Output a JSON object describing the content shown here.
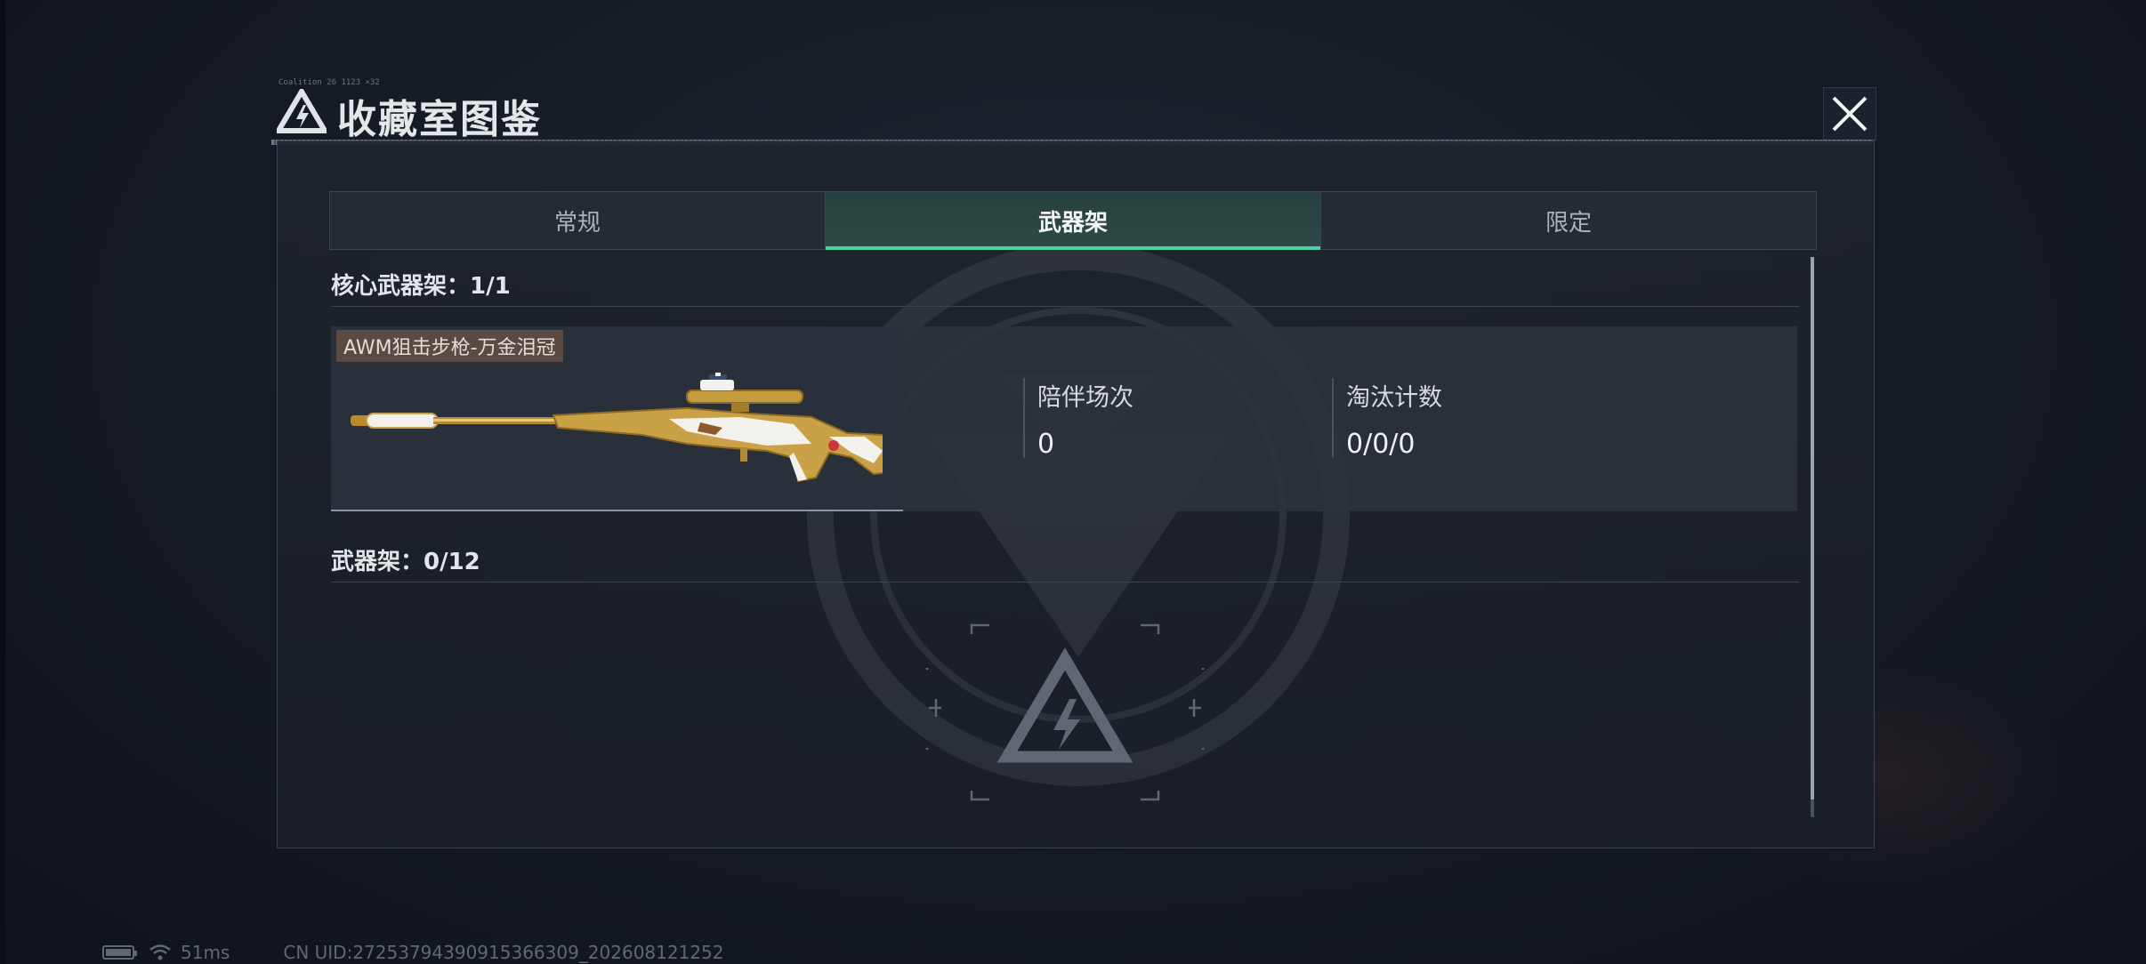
{
  "header": {
    "title": "收藏室图鉴",
    "tiny_caption": "Coalition 26 1123 ×32"
  },
  "tabs": [
    {
      "label": "常规",
      "active": false
    },
    {
      "label": "武器架",
      "active": true
    },
    {
      "label": "限定",
      "active": false
    }
  ],
  "core_section": {
    "label": "核心武器架：1/1"
  },
  "weapon": {
    "name": "AWM狙击步枪-万金泪冠",
    "stats": [
      {
        "label": "陪伴场次",
        "value": "0"
      },
      {
        "label": "淘汰计数",
        "value": "0/0/0"
      }
    ]
  },
  "rack_section": {
    "label": "武器架：0/12"
  },
  "status_bar": {
    "ping": "51ms",
    "uid": "CN UID:27253794390915366309_202608121252"
  },
  "colors": {
    "accent": "#4fd3a5",
    "background": "#151b22",
    "panel": "#1e242c",
    "tag_bg": "#5a4a44",
    "gold": "#c9a24a"
  },
  "icons": [
    "logo-icon",
    "close-icon",
    "rifle-image",
    "empty-slot-icon",
    "battery-icon",
    "wifi-icon"
  ]
}
